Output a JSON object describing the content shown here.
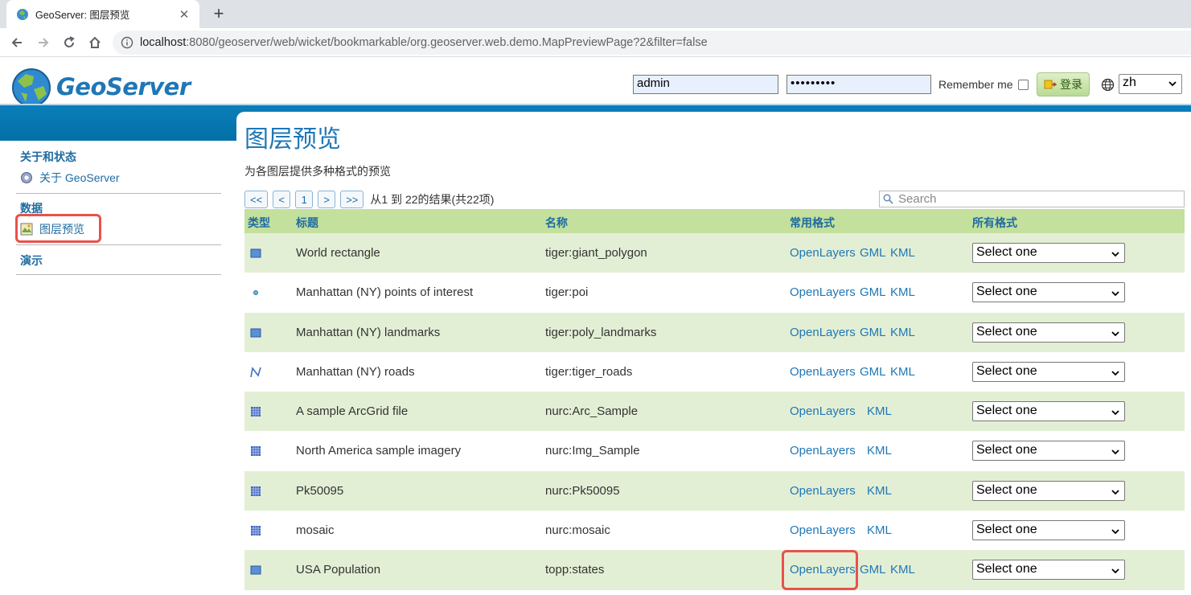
{
  "browser": {
    "tab_title": "GeoServer: 图层预览",
    "tab_close": "✕",
    "new_tab": "+",
    "url_host": "localhost",
    "url_rest": ":8080/geoserver/web/wicket/bookmarkable/org.geoserver.web.demo.MapPreviewPage?2&filter=false"
  },
  "header": {
    "logo_text": "GeoServer",
    "username": "admin",
    "password": "•••••••••",
    "remember_label": "Remember me",
    "login_label": "登录",
    "language": "zh"
  },
  "sidebar": {
    "sections": [
      {
        "category": "关于和状态",
        "items": [
          {
            "label": "关于 GeoServer",
            "icon": "info-icon"
          }
        ]
      },
      {
        "category": "数据",
        "items": [
          {
            "label": "图层预览",
            "icon": "layer-preview-icon"
          }
        ]
      },
      {
        "category": "演示",
        "items": []
      }
    ]
  },
  "main": {
    "title": "图层预览",
    "description": "为各图层提供多种格式的预览",
    "pager": {
      "first": "<<",
      "prev": "<",
      "current": "1",
      "next": ">",
      "last": ">>",
      "info": "从1 到 22的结果(共22项)"
    },
    "search_placeholder": "Search",
    "columns": {
      "type": "类型",
      "title": "标题",
      "name": "名称",
      "common": "常用格式",
      "all": "所有格式"
    },
    "rows": [
      {
        "type": "polygon",
        "title": "World rectangle",
        "name": "tiger:giant_polygon",
        "formats": [
          "OpenLayers",
          "GML",
          "KML"
        ],
        "select": "Select one"
      },
      {
        "type": "point",
        "title": "Manhattan (NY) points of interest",
        "name": "tiger:poi",
        "formats": [
          "OpenLayers",
          "GML",
          "KML"
        ],
        "select": "Select one"
      },
      {
        "type": "polygon",
        "title": "Manhattan (NY) landmarks",
        "name": "tiger:poly_landmarks",
        "formats": [
          "OpenLayers",
          "GML",
          "KML"
        ],
        "select": "Select one"
      },
      {
        "type": "line",
        "title": "Manhattan (NY) roads",
        "name": "tiger:tiger_roads",
        "formats": [
          "OpenLayers",
          "GML",
          "KML"
        ],
        "select": "Select one"
      },
      {
        "type": "raster",
        "title": "A sample ArcGrid file",
        "name": "nurc:Arc_Sample",
        "formats": [
          "OpenLayers",
          "",
          "KML"
        ],
        "select": "Select one"
      },
      {
        "type": "raster",
        "title": "North America sample imagery",
        "name": "nurc:Img_Sample",
        "formats": [
          "OpenLayers",
          "",
          "KML"
        ],
        "select": "Select one"
      },
      {
        "type": "raster",
        "title": "Pk50095",
        "name": "nurc:Pk50095",
        "formats": [
          "OpenLayers",
          "",
          "KML"
        ],
        "select": "Select one"
      },
      {
        "type": "raster",
        "title": "mosaic",
        "name": "nurc:mosaic",
        "formats": [
          "OpenLayers",
          "",
          "KML"
        ],
        "select": "Select one"
      },
      {
        "type": "polygon",
        "title": "USA Population",
        "name": "topp:states",
        "formats": [
          "OpenLayers",
          "GML",
          "KML"
        ],
        "select": "Select one"
      }
    ]
  },
  "colors": {
    "accent_blue": "#1f77b6",
    "header_band": "#0a7fbb",
    "row_green": "#e3efd5",
    "head_green": "#c3e09d",
    "highlight_red": "#e8524a"
  }
}
